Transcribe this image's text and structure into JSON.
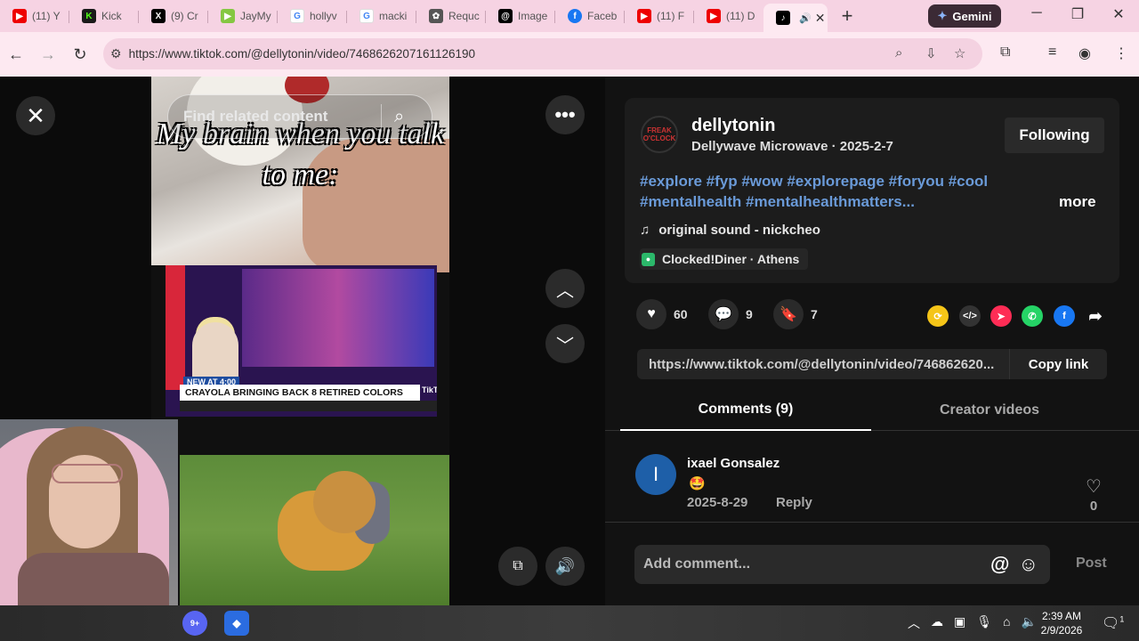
{
  "browser": {
    "tabs": [
      {
        "label": "(11) Y",
        "icon": "youtube-icon",
        "color": "#e00"
      },
      {
        "label": "Kick",
        "icon": "kick-icon",
        "color": "#1a1a1a"
      },
      {
        "label": "(9) Cr",
        "icon": "x-icon",
        "color": "#000"
      },
      {
        "label": "JayMy",
        "icon": "rumble-icon",
        "color": "#85c742"
      },
      {
        "label": "hollyv",
        "icon": "google-icon",
        "color": "#4285f4"
      },
      {
        "label": "macki",
        "icon": "google-icon",
        "color": "#4285f4"
      },
      {
        "label": "Requc",
        "icon": "openai-icon",
        "color": "#555"
      },
      {
        "label": "Image",
        "icon": "threads-icon",
        "color": "#000"
      },
      {
        "label": "Faceb",
        "icon": "facebook-icon",
        "color": "#1877f2"
      },
      {
        "label": "(11) F",
        "icon": "youtube-icon",
        "color": "#e00"
      },
      {
        "label": "(11) D",
        "icon": "youtube-icon",
        "color": "#e00"
      }
    ],
    "active_tab": {
      "icon": "tiktok-icon",
      "speaker": "🔊",
      "close": "✕"
    },
    "new_tab": "+",
    "gemini_label": "Gemini",
    "url": "https://www.tiktok.com/@dellytonin/video/7468626207161126190"
  },
  "video": {
    "search_placeholder": "Find related content",
    "meme_text": "My brain when you talk to me:",
    "news_tag": "NEW AT 4:00",
    "news_ticker": "CRAYOLA BRINGING BACK 8 RETIRED COLORS",
    "tiktok_mark": "TikTok"
  },
  "post": {
    "avatar_text": "FREAK O'CLOCK",
    "username": "dellytonin",
    "subline": "Dellywave Microwave · 2025-2-7",
    "follow_label": "Following",
    "hashtags": "#explore #fyp #wow #explorepage #foryou #cool #mentalhealth #mentalhealthmatters...",
    "more_label": "more",
    "sound": "original sound - nickcheo",
    "location": "Clocked!Diner · Athens",
    "likes": "60",
    "comments": "9",
    "saves": "7",
    "link": "https://www.tiktok.com/@dellytonin/video/746862620...",
    "copy_label": "Copy link"
  },
  "tabs": {
    "comments": "Comments (9)",
    "creator": "Creator videos"
  },
  "comment": {
    "avatar_letter": "I",
    "name": "ixael Gonsalez",
    "text": "🤩",
    "date": "2025-8-29",
    "reply": "Reply",
    "likes": "0"
  },
  "composer": {
    "placeholder": "Add comment...",
    "post_label": "Post"
  },
  "taskbar": {
    "discord_badge": "9+",
    "time": "2:39 AM",
    "date": "2/9/2026",
    "notif_count": "1"
  }
}
